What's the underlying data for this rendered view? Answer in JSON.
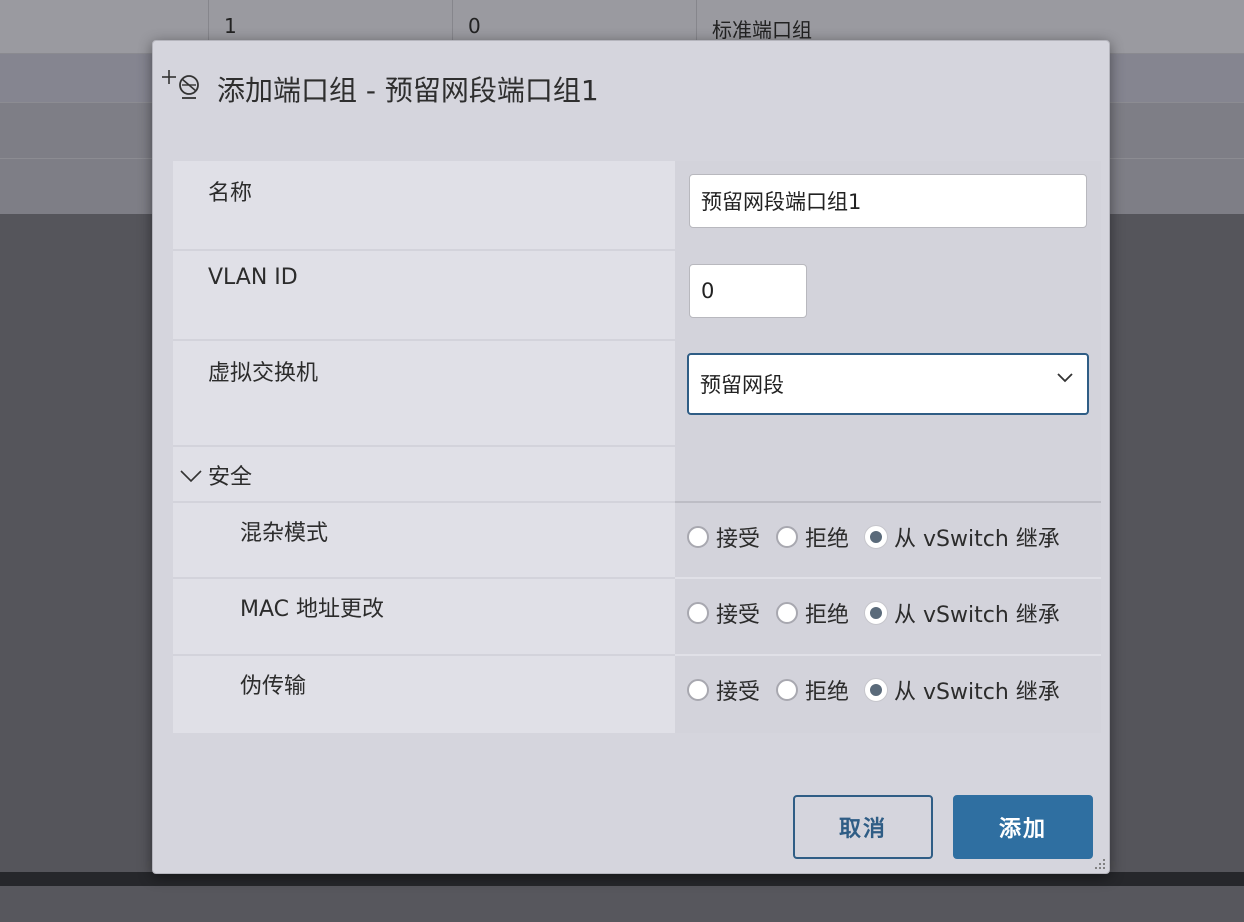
{
  "background_table": {
    "row1": [
      "1",
      "0",
      "标准端口组"
    ]
  },
  "dialog": {
    "icon": "add-port-group-icon",
    "title": "添加端口组 - 预留网段端口组1",
    "fields": {
      "name": {
        "label": "名称",
        "value": "预留网段端口组1"
      },
      "vlan": {
        "label": "VLAN ID",
        "value": "0"
      },
      "vswitch": {
        "label": "虚拟交换机",
        "selected": "预留网段"
      }
    },
    "security": {
      "label": "安全",
      "expanded": true,
      "options": [
        "接受",
        "拒绝",
        "从 vSwitch 继承"
      ],
      "rows": [
        {
          "label": "混杂模式",
          "selected": "从 vSwitch 继承"
        },
        {
          "label": "MAC 地址更改",
          "selected": "从 vSwitch 继承"
        },
        {
          "label": "伪传输",
          "selected": "从 vSwitch 继承"
        }
      ]
    },
    "buttons": {
      "cancel": "取消",
      "add": "添加"
    }
  },
  "colors": {
    "accent": "#2f6fa1",
    "accent_border": "#2f5d85",
    "dialog_bg": "#d5d5dd",
    "overlay": "#55555b"
  }
}
